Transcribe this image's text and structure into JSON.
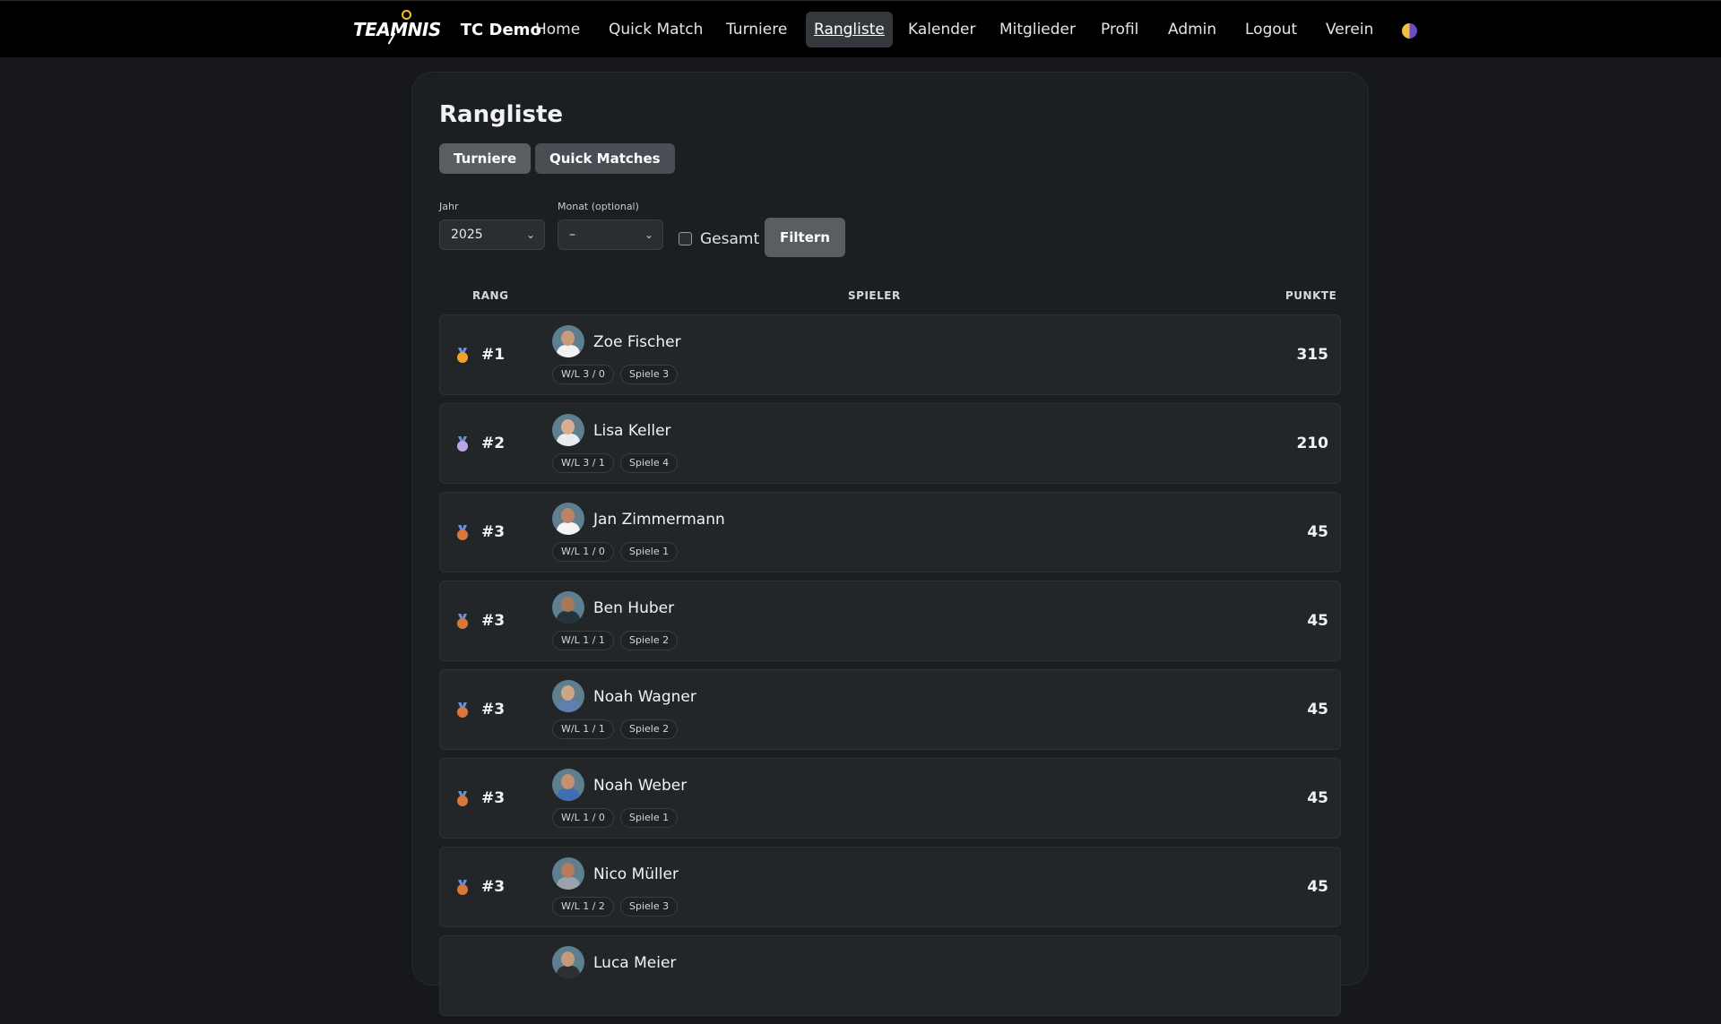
{
  "header": {
    "logo_text": "TEAMNIS",
    "club_name": "TC Demo",
    "nav": [
      {
        "label": "Home",
        "active": false
      },
      {
        "label": "Quick Match",
        "active": false
      },
      {
        "label": "Turniere",
        "active": false
      },
      {
        "label": "Rangliste",
        "active": true
      },
      {
        "label": "Kalender",
        "active": false
      },
      {
        "label": "Mitglieder",
        "active": false
      },
      {
        "label": "Profil",
        "active": false
      },
      {
        "label": "Admin",
        "active": false
      },
      {
        "label": "Logout",
        "active": false
      },
      {
        "label": "Verein",
        "active": false
      }
    ],
    "theme_icon": "theme-toggle-icon"
  },
  "main": {
    "title": "Rangliste",
    "tabs": [
      {
        "label": "Turniere"
      },
      {
        "label": "Quick Matches"
      }
    ],
    "filters": {
      "year_label": "Jahr",
      "year_value": "2025",
      "month_label": "Monat (optional)",
      "month_value": "–",
      "total_label": "Gesamt",
      "total_checked": false,
      "submit_label": "Filtern"
    },
    "columns": {
      "rank": "RANG",
      "player": "SPIELER",
      "points": "PUNKTE"
    },
    "rows": [
      {
        "medal": "gold",
        "rank": "#1",
        "name": "Zoe Fischer",
        "wl": "W/L 3 / 0",
        "games": "Spiele 3",
        "points": "315"
      },
      {
        "medal": "silver",
        "rank": "#2",
        "name": "Lisa Keller",
        "wl": "W/L 3 / 1",
        "games": "Spiele 4",
        "points": "210"
      },
      {
        "medal": "bronze",
        "rank": "#3",
        "name": "Jan Zimmermann",
        "wl": "W/L 1 / 0",
        "games": "Spiele 1",
        "points": "45"
      },
      {
        "medal": "bronze",
        "rank": "#3",
        "name": "Ben Huber",
        "wl": "W/L 1 / 1",
        "games": "Spiele 2",
        "points": "45"
      },
      {
        "medal": "bronze",
        "rank": "#3",
        "name": "Noah Wagner",
        "wl": "W/L 1 / 1",
        "games": "Spiele 2",
        "points": "45"
      },
      {
        "medal": "bronze",
        "rank": "#3",
        "name": "Noah Weber",
        "wl": "W/L 1 / 0",
        "games": "Spiele 1",
        "points": "45"
      },
      {
        "medal": "bronze",
        "rank": "#3",
        "name": "Nico Müller",
        "wl": "W/L 1 / 2",
        "games": "Spiele 3",
        "points": "45"
      },
      {
        "medal": "",
        "rank": "",
        "name": "Luca Meier",
        "wl": "",
        "games": "",
        "points": ""
      }
    ],
    "colors": {
      "gold": "#f0a12a",
      "silver": "#b9a6e6",
      "bronze": "#d8773a"
    }
  }
}
